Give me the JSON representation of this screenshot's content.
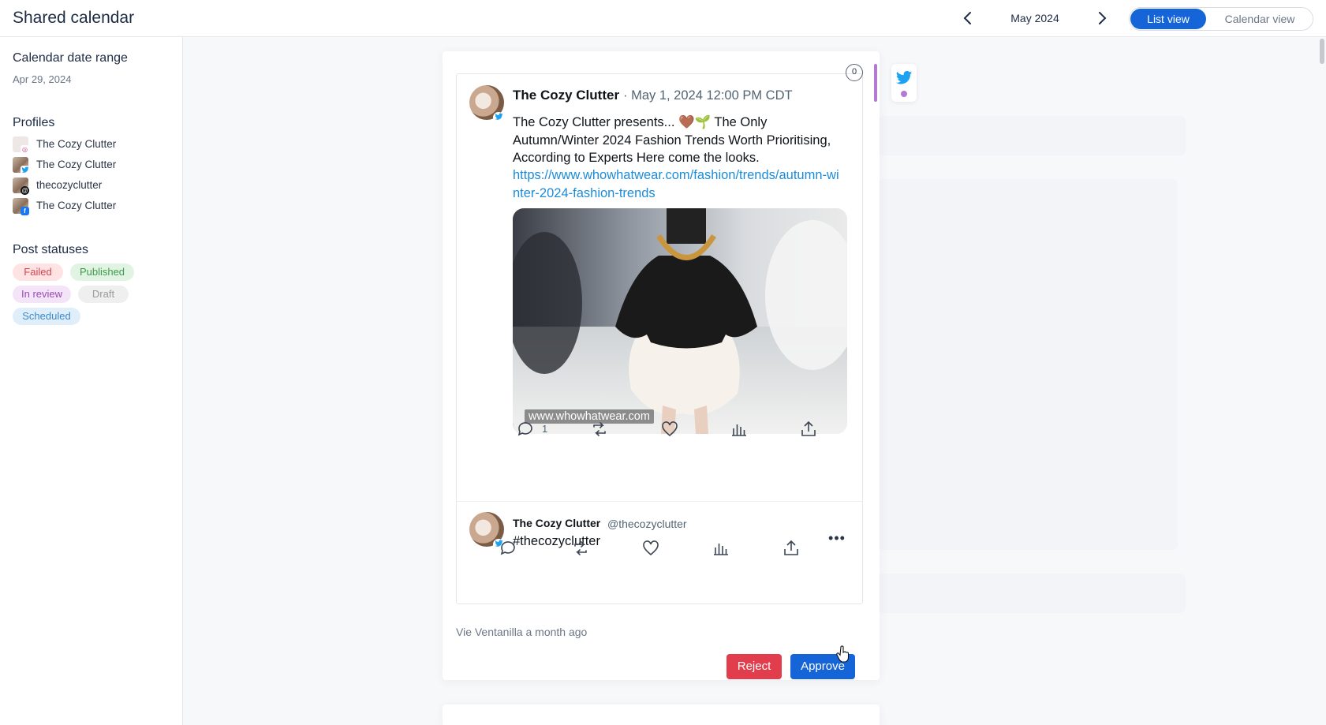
{
  "header": {
    "title": "Shared calendar",
    "month": "May 2024",
    "views": {
      "list": "List view",
      "calendar": "Calendar view",
      "active": "list"
    }
  },
  "sidebar": {
    "date_range_label": "Calendar date range",
    "date_range_value": "Apr 29, 2024",
    "profiles_label": "Profiles",
    "profiles": [
      {
        "name": "The Cozy Clutter",
        "network": "instagram"
      },
      {
        "name": "The Cozy Clutter",
        "network": "twitter"
      },
      {
        "name": "thecozyclutter",
        "network": "threads"
      },
      {
        "name": "The Cozy Clutter",
        "network": "facebook"
      }
    ],
    "statuses_label": "Post statuses",
    "statuses": [
      "Failed",
      "Published",
      "In review",
      "Draft",
      "Scheduled"
    ]
  },
  "post": {
    "comment_count": "0",
    "network_icon": "twitter-icon",
    "author": "The Cozy Clutter",
    "datetime": "· May 1, 2024 12:00 PM CDT",
    "text": "The Cozy Clutter presents... 🤎🌱 The Only Autumn/Winter 2024 Fashion Trends Worth Prioritising, According to Experts Here come the looks.",
    "link": "https://www.whowhatwear.com/fashion/trends/autumn-winter-2024-fashion-trends",
    "image_watermark": "www.whowhatwear.com",
    "reply_count": "1",
    "reply": {
      "author": "The Cozy Clutter",
      "handle": "@thecozyclutter",
      "text": "#thecozyclutter"
    },
    "footer": "Vie Ventanilla a month ago",
    "reject_label": "Reject",
    "approve_label": "Approve"
  },
  "colors": {
    "primary": "#1565d8",
    "reject": "#e23d4c",
    "in_review_accent": "#b47ad3",
    "twitter": "#1da1f2",
    "link": "#1d8cd8"
  }
}
